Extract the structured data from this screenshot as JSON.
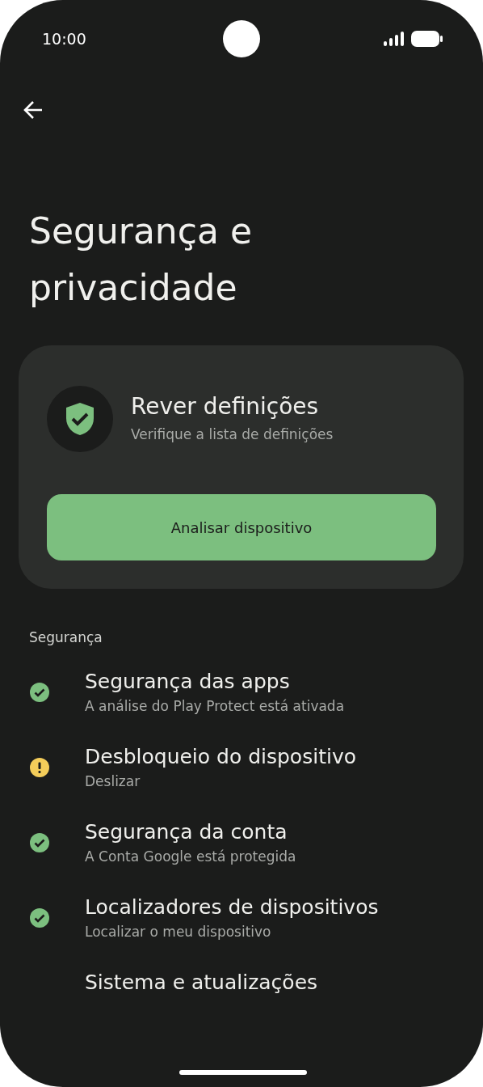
{
  "status_bar": {
    "time": "10:00"
  },
  "title": "Segurança e privacidade",
  "review_card": {
    "title": "Rever definições",
    "subtitle": "Verifique a lista de definições",
    "button": "Analisar dispositivo"
  },
  "section": "Segurança",
  "items": [
    {
      "title": "Segurança das apps",
      "subtitle": "A análise do Play Protect está ativada",
      "kind": "ok"
    },
    {
      "title": "Desbloqueio do dispositivo",
      "subtitle": "Deslizar",
      "kind": "warning"
    },
    {
      "title": "Segurança da conta",
      "subtitle": "A Conta Google está protegida",
      "kind": "ok"
    },
    {
      "title": "Localizadores de dispositivos",
      "subtitle": "Localizar o meu dispositivo",
      "kind": "ok"
    },
    {
      "title": "Sistema e atualizações",
      "kind": "none"
    }
  ]
}
